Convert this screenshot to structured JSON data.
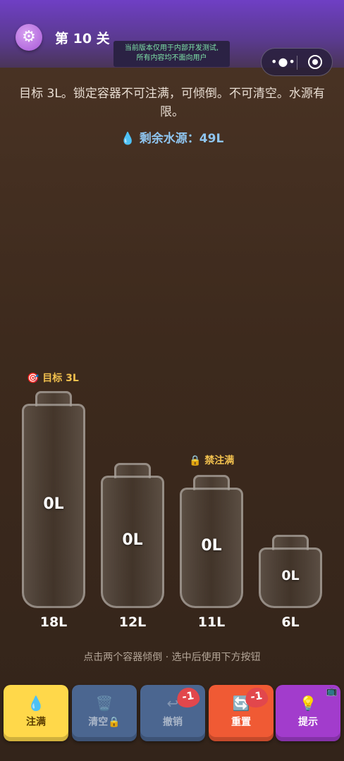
{
  "header": {
    "level_title": "第 10 关",
    "dev_notice_line1": "当前版本仅用于内部开发测试,",
    "dev_notice_line2": "所有内容均不面向用户"
  },
  "game": {
    "description": "目标 3L。锁定容器不可注满，可倾倒。不可清空。水源有限。",
    "water_remaining": "💧 剩余水源：49L",
    "target_label": "🎯 目标 3L",
    "locked_label": "🔒 禁注满",
    "containers": [
      {
        "amount": "0L",
        "capacity": "18L"
      },
      {
        "amount": "0L",
        "capacity": "12L"
      },
      {
        "amount": "0L",
        "capacity": "11L"
      },
      {
        "amount": "0L",
        "capacity": "6L"
      }
    ],
    "instructions": "点击两个容器倾倒 · 选中后使用下方按钮"
  },
  "toolbar": {
    "fill": {
      "icon": "💧",
      "label": "注满",
      "color": "#ffd84a"
    },
    "empty": {
      "icon": "🗑️",
      "label": "清空🔒",
      "color": "#4b6690"
    },
    "undo": {
      "icon": "↩",
      "label": "撤销",
      "badge": "-1",
      "color": "#4b6690"
    },
    "reset": {
      "icon": "🔄",
      "label": "重置",
      "badge": "-1",
      "color": "#f05a34"
    },
    "hint": {
      "icon": "💡",
      "label": "提示",
      "corner_icon": "📺",
      "color": "#a23ccc"
    }
  }
}
